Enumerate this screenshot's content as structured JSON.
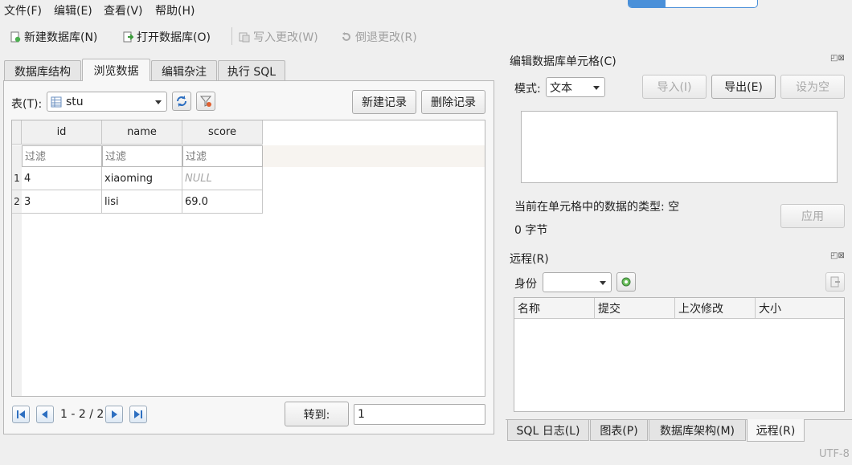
{
  "menubar": {
    "file": "文件(F)",
    "edit": "编辑(E)",
    "view": "查看(V)",
    "help": "帮助(H)"
  },
  "toolbar": {
    "new_db": "新建数据库(N)",
    "open_db": "打开数据库(O)",
    "write_changes": "写入更改(W)",
    "revert_changes": "倒退更改(R)"
  },
  "tabs": {
    "structure": "数据库结构",
    "browse": "浏览数据",
    "edit_pragmas": "编辑杂注",
    "execute_sql": "执行 SQL"
  },
  "browse": {
    "table_label": "表(T):",
    "table_value": "stu",
    "new_record": "新建记录",
    "delete_record": "删除记录",
    "columns": [
      "id",
      "name",
      "score"
    ],
    "filter_placeholder": "过滤",
    "rows": [
      {
        "num": "1",
        "id": "4",
        "name": "xiaoming",
        "score": "NULL"
      },
      {
        "num": "2",
        "id": "3",
        "name": "lisi",
        "score": "69.0"
      }
    ],
    "pagination": "1 - 2 / 2",
    "goto_label": "转到:",
    "goto_value": "1"
  },
  "edit_cell": {
    "title": "编辑数据库单元格(C)",
    "mode_label": "模式:",
    "mode_value": "文本",
    "import": "导入(I)",
    "export": "导出(E)",
    "set_null": "设为空",
    "type_info": "当前在单元格中的数据的类型: 空",
    "size_info": "0 字节",
    "apply": "应用"
  },
  "remote": {
    "title": "远程(R)",
    "identity_label": "身份",
    "columns": [
      "名称",
      "提交",
      "上次修改",
      "大小"
    ]
  },
  "bottom_tabs": {
    "sql_log": "SQL 日志(L)",
    "plot": "图表(P)",
    "schema": "数据库架构(M)",
    "remote": "远程(R)"
  },
  "status": {
    "encoding": "UTF-8"
  },
  "colors": {
    "accent": "#4a90d9",
    "null_text": "#a8a8a8",
    "disabled_text": "#a0a0a0"
  }
}
